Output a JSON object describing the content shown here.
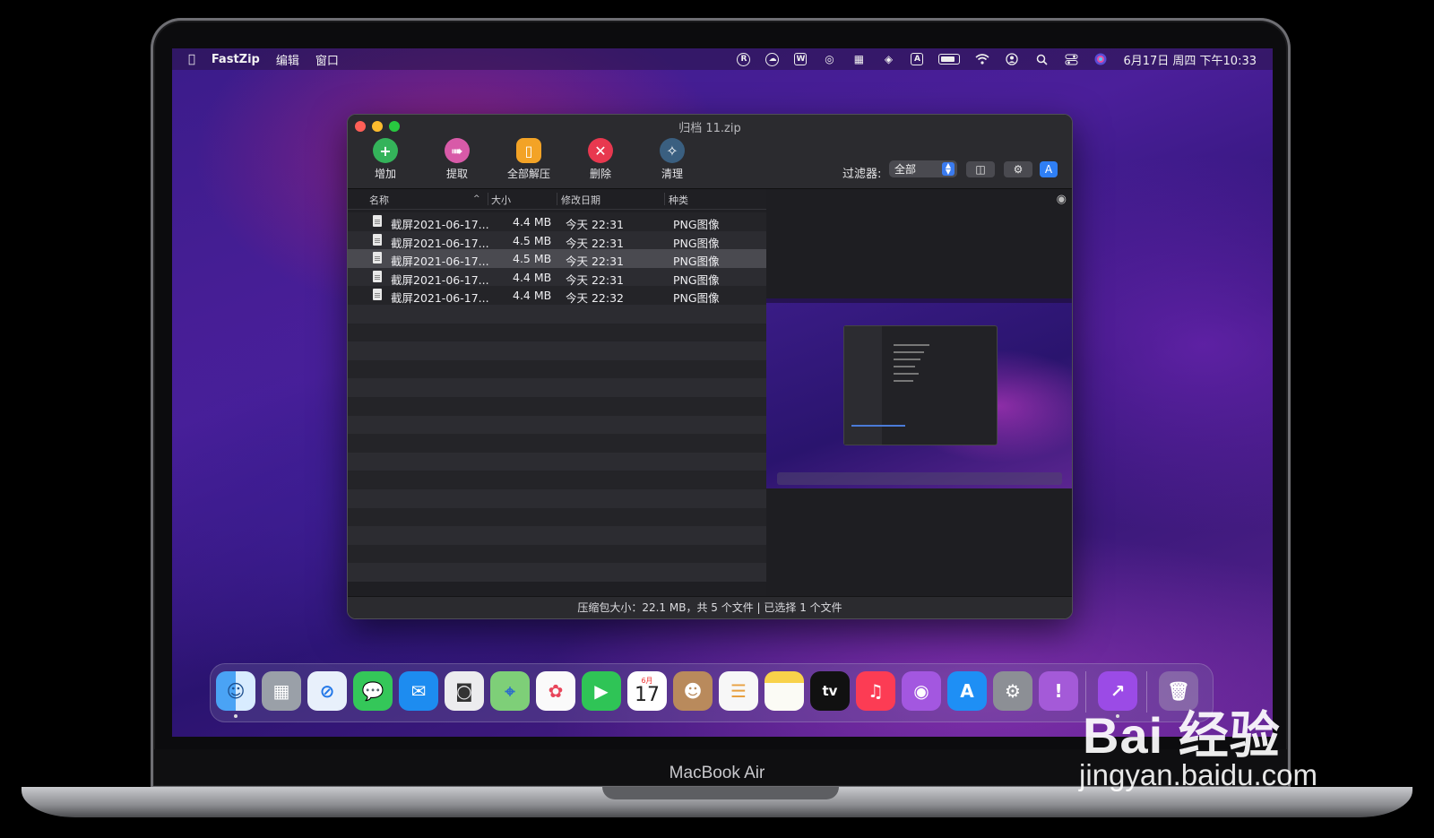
{
  "menubar": {
    "app_name": "FastZip",
    "menus": [
      "编辑",
      "窗口"
    ],
    "status_icons": [
      "R",
      "☁",
      "W",
      "◎",
      "▦",
      "◈",
      "A"
    ],
    "datetime": "6月17日 周四 下午10:33"
  },
  "window": {
    "title": "归档 11.zip",
    "toolbar": {
      "add": "增加",
      "extract": "提取",
      "extract_all": "全部解压",
      "delete": "删除",
      "clean": "清理",
      "filter_label": "过滤器:",
      "filter_value": "全部"
    },
    "columns": {
      "name": "名称",
      "size": "大小",
      "modified": "修改日期",
      "kind": "种类"
    },
    "files": [
      {
        "name": "截屏2021-06-17...",
        "size": "4.4 MB",
        "date": "今天 22:31",
        "kind": "PNG图像"
      },
      {
        "name": "截屏2021-06-17...",
        "size": "4.5 MB",
        "date": "今天 22:31",
        "kind": "PNG图像"
      },
      {
        "name": "截屏2021-06-17...",
        "size": "4.5 MB",
        "date": "今天 22:31",
        "kind": "PNG图像"
      },
      {
        "name": "截屏2021-06-17...",
        "size": "4.4 MB",
        "date": "今天 22:31",
        "kind": "PNG图像"
      },
      {
        "name": "截屏2021-06-17...",
        "size": "4.4 MB",
        "date": "今天 22:32",
        "kind": "PNG图像"
      }
    ],
    "status": "压缩包大小：22.1 MB，共 5 个文件 | 已选择 1 个文件"
  },
  "dock": {
    "calendar_day": "17",
    "calendar_month": "6月",
    "tv_label": "tv"
  },
  "device": {
    "model": "MacBook Air"
  },
  "watermark": {
    "brand": "Bai 经验",
    "url": "jingyan.baidu.com"
  }
}
